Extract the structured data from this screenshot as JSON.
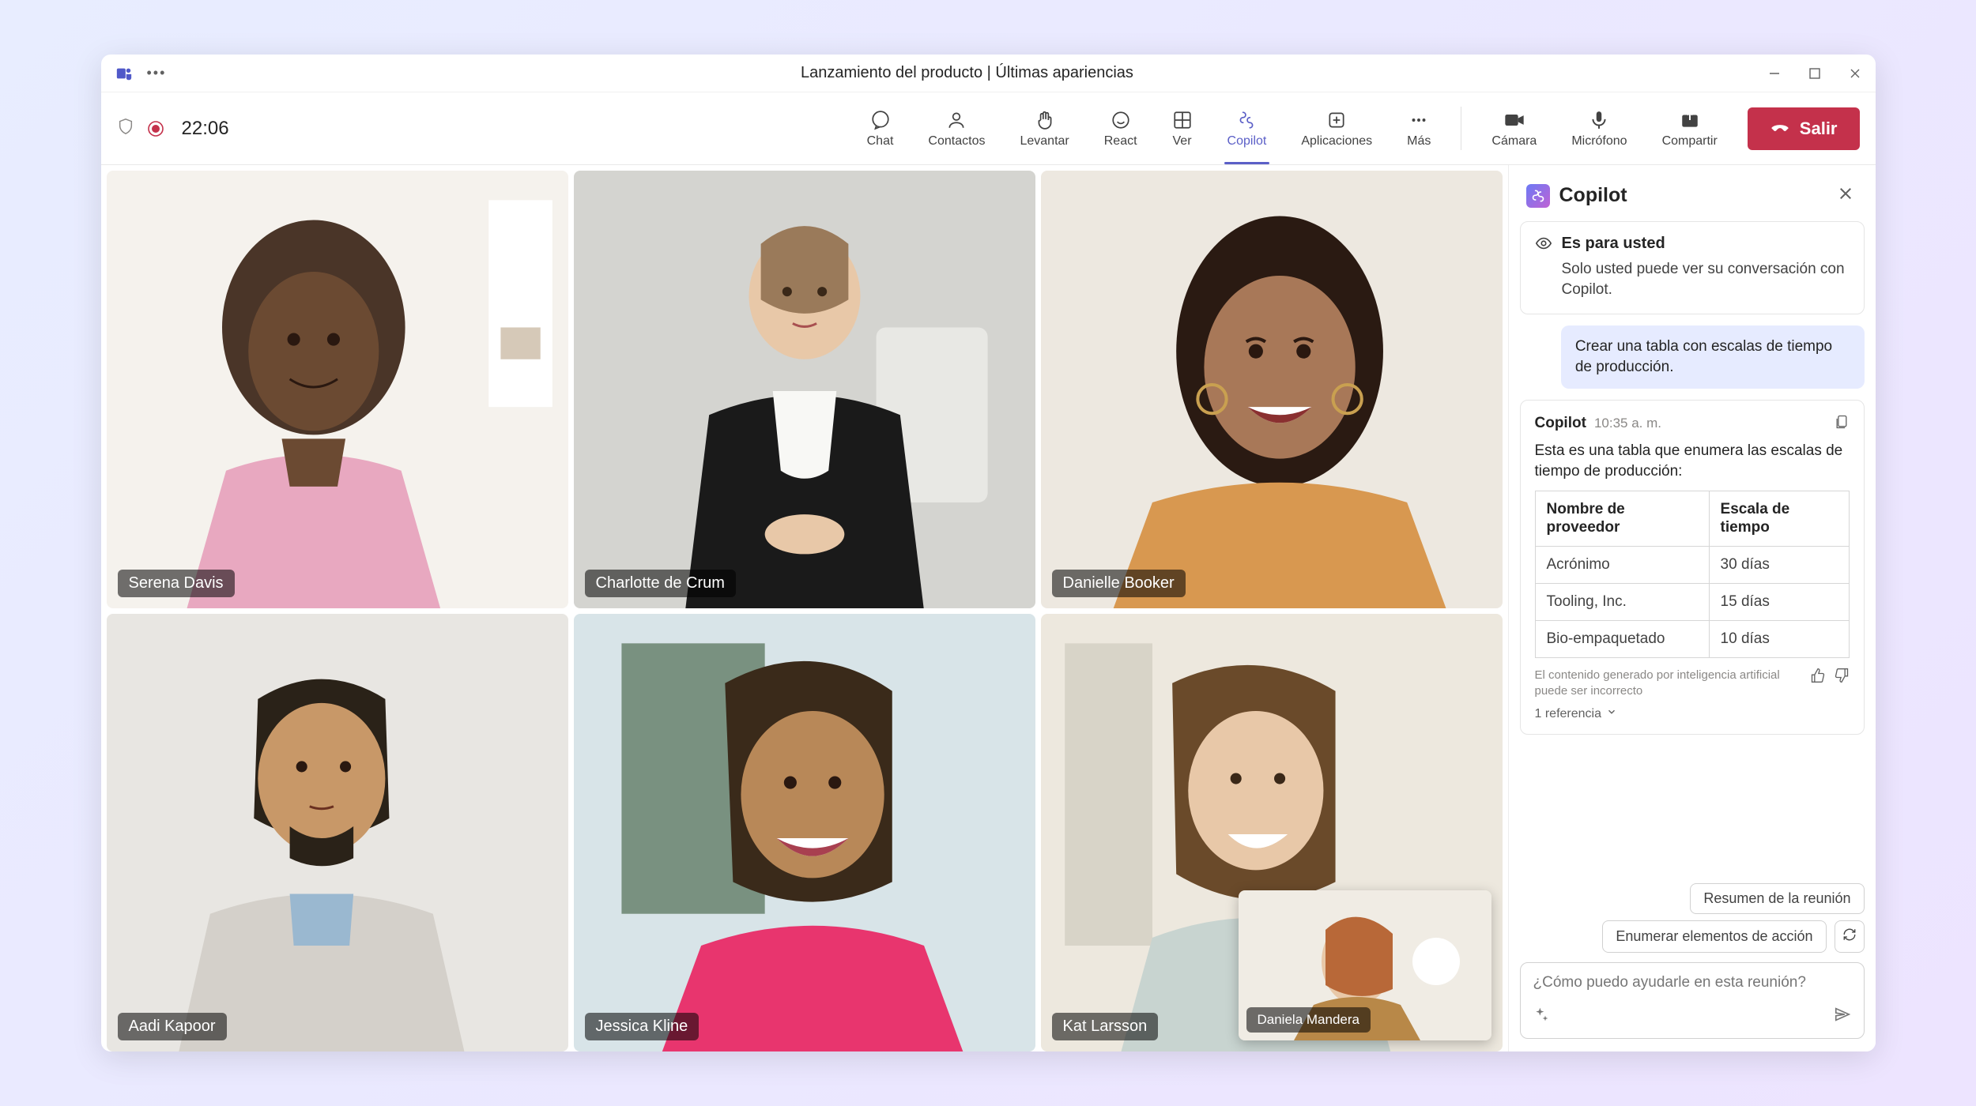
{
  "titlebar": {
    "title": "Lanzamiento del producto | Últimas apariencias"
  },
  "status": {
    "timer": "22:06"
  },
  "toolbar": {
    "chat": "Chat",
    "people": "Contactos",
    "raise": "Levantar",
    "react": "React",
    "view": "Ver",
    "copilot": "Copilot",
    "apps": "Aplicaciones",
    "more": "Más",
    "camera": "Cámara",
    "mic": "Micrófono",
    "share": "Compartir",
    "leave": "Salir"
  },
  "participants": {
    "p0": "Serena Davis",
    "p1": "Charlotte de Crum",
    "p2": "Danielle Booker",
    "p3": "Aadi Kapoor",
    "p4": "Jessica Kline",
    "p5": "Kat Larsson",
    "pip": "Daniela Mandera"
  },
  "copilot": {
    "title": "Copilot",
    "privacy": {
      "title": "Es para usted",
      "body": "Solo usted puede ver su conversación con Copilot."
    },
    "user_query": "Crear una tabla con escalas de tiempo de producción.",
    "answer": {
      "name": "Copilot",
      "time": "10:35 a. m.",
      "intro": "Esta es una tabla que enumera las escalas de tiempo de producción:",
      "table": {
        "headers": {
          "c0": "Nombre de proveedor",
          "c1": "Escala de tiempo"
        },
        "rows": [
          {
            "c0": "Acrónimo",
            "c1": "30 días"
          },
          {
            "c0": "Tooling, Inc.",
            "c1": "15 días"
          },
          {
            "c0": "Bio-empaquetado",
            "c1": "10 días"
          }
        ]
      },
      "disclaimer": "El contenido generado por inteligencia artificial puede ser incorrecto",
      "reference": "1 referencia"
    },
    "suggestions": {
      "s0": "Resumen de la reunión",
      "s1": "Enumerar elementos de acción"
    },
    "input_placeholder": "¿Cómo puedo ayudarle en esta reunión?"
  }
}
